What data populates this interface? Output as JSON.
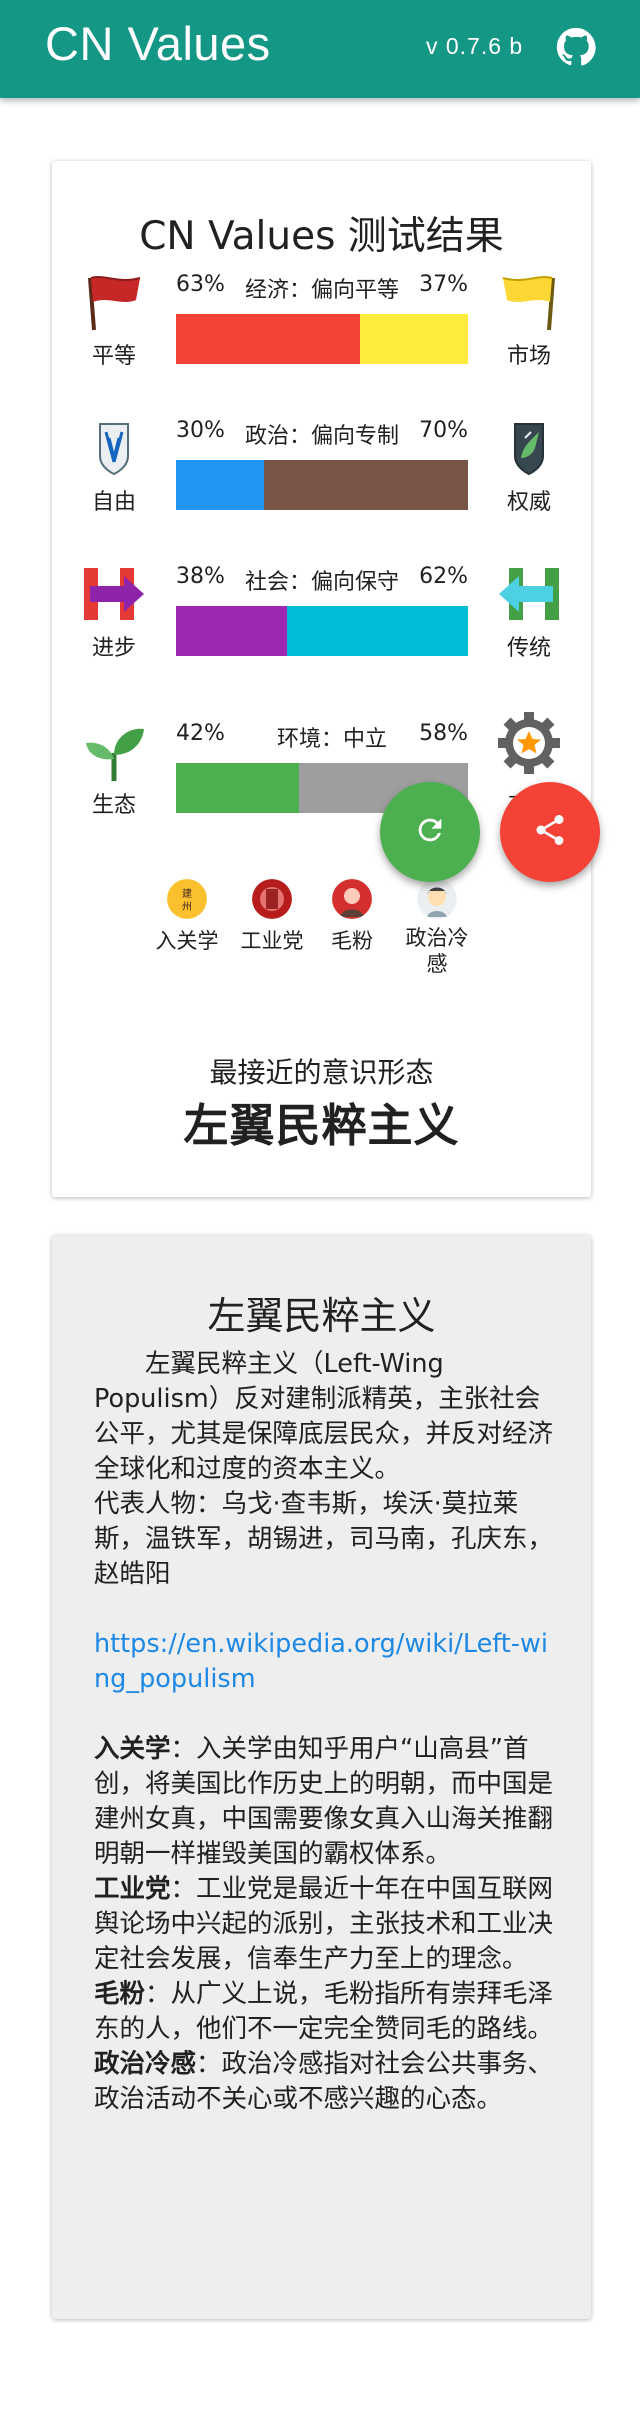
{
  "app": {
    "title": "CN Values",
    "version": "v 0.7.6 b"
  },
  "result": {
    "title": "CN Values 测试结果",
    "axes": [
      {
        "name": "经济：偏向平等",
        "left_label": "平等",
        "right_label": "市场",
        "left_pct": "63%",
        "right_pct": "37%",
        "left_value": 63,
        "left_color": "#f44336",
        "right_color": "#ffeb3b",
        "left_icon": "red-flag-icon",
        "right_icon": "yellow-flag-icon"
      },
      {
        "name": "政治：偏向专制",
        "left_label": "自由",
        "right_label": "权威",
        "left_pct": "30%",
        "right_pct": "70%",
        "left_value": 30,
        "left_color": "#2196f3",
        "right_color": "#795548",
        "left_icon": "wings-emblem-icon",
        "right_icon": "unicorn-emblem-icon"
      },
      {
        "name": "社会：偏向保守",
        "left_label": "进步",
        "right_label": "传统",
        "left_pct": "38%",
        "right_pct": "62%",
        "left_value": 38,
        "left_color": "#9c27b0",
        "right_color": "#00bcd4",
        "left_icon": "h-arrow-right-icon",
        "right_icon": "h-arrow-left-icon"
      },
      {
        "name": "环境：中立",
        "left_label": "生态",
        "right_label": "工业",
        "left_pct": "42%",
        "right_pct": "58%",
        "left_value": 42,
        "left_color": "#4caf50",
        "right_color": "#9e9e9e",
        "left_icon": "sprout-icon",
        "right_icon": "gear-star-icon"
      }
    ],
    "labels": [
      {
        "text": "入关学",
        "icon": "ruguan-avatar"
      },
      {
        "text": "工业党",
        "icon": "gongyedang-avatar"
      },
      {
        "text": "毛粉",
        "icon": "maofen-avatar"
      },
      {
        "text": "政治冷感",
        "icon": "apathy-avatar"
      }
    ],
    "closest_caption": "最接近的意识形态",
    "closest_ideology": "左翼民粹主义"
  },
  "description": {
    "title": "左翼民粹主义",
    "intro": "左翼民粹主义（Left-Wing Populism）反对建制派精英，主张社会公平，尤其是保障底层民众，并反对经济全球化和过度的资本主义。",
    "figures": "代表人物：乌戈·查韦斯，埃沃·莫拉莱斯，温铁军，胡锡进，司马南，孔庆东，赵皓阳",
    "link": "https://en.wikipedia.org/wiki/Left-wing_populism",
    "terms": [
      {
        "term": "入关学",
        "text": "：入关学由知乎用户“山高县”首创，将美国比作历史上的明朝，而中国是建州女真，中国需要像女真入山海关推翻明朝一样摧毁美国的霸权体系。"
      },
      {
        "term": "工业党",
        "text": "：工业党是最近十年在中国互联网舆论场中兴起的派别，主张技术和工业决定社会发展，信奉生产力至上的理念。"
      },
      {
        "term": "毛粉",
        "text": "：从广义上说，毛粉指所有崇拜毛泽东的人，他们不一定完全赞同毛的路线。"
      },
      {
        "term": "政治冷感",
        "text": "：政治冷感指对社会公共事务、政治活动不关心或不感兴趣的心态。"
      }
    ]
  },
  "colors": {
    "appbar": "#159786",
    "fab_refresh": "#4caf50",
    "fab_share": "#f44336",
    "link": "#1e88e5"
  }
}
